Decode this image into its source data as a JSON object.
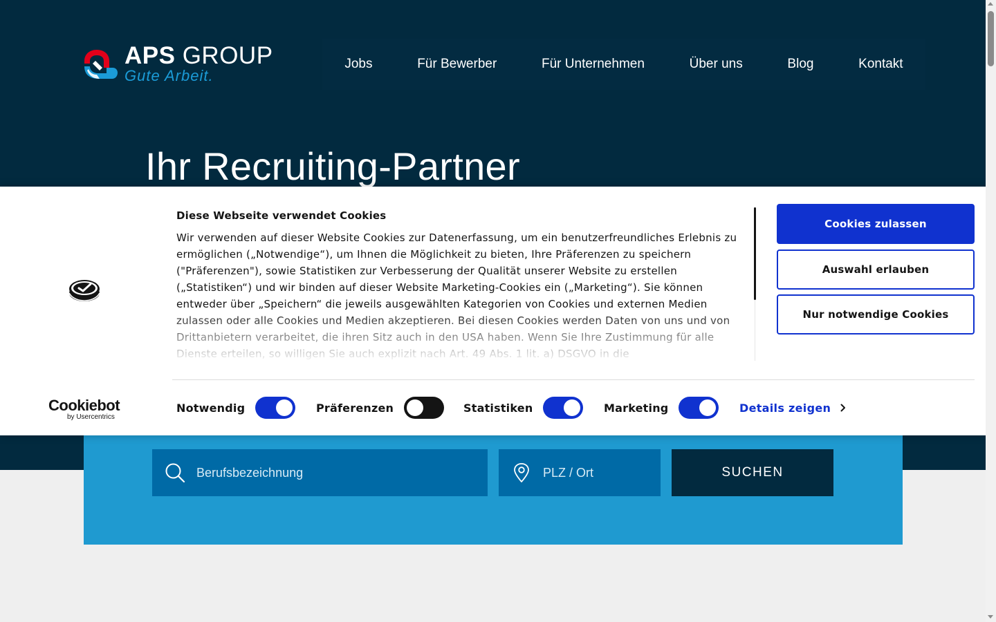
{
  "header": {
    "logo": {
      "name": "APS",
      "name_suffix": "GROUP",
      "tagline": "Gute Arbeit."
    },
    "nav": [
      {
        "label": "Jobs"
      },
      {
        "label": "Für Bewerber"
      },
      {
        "label": "Für Unternehmen"
      },
      {
        "label": "Über uns"
      },
      {
        "label": "Blog"
      },
      {
        "label": "Kontakt"
      }
    ]
  },
  "hero": {
    "title": "Ihr Recruiting-Partner"
  },
  "search": {
    "job_placeholder": "Berufsbezeichnung",
    "location_placeholder": "PLZ / Ort",
    "button_label": "SUCHEN"
  },
  "cookie_banner": {
    "title": "Diese Webseite verwendet Cookies",
    "text": "Wir verwenden auf dieser Website Cookies zur Datenerfassung, um ein benutzerfreundliches Erlebnis zu ermöglichen („Notwendige“), um Ihnen die Möglichkeit zu bieten, Ihre Präferenzen zu speichern (\"Präferenzen\"), sowie Statistiken zur Verbesserung der Qualität unserer Website zu erstellen („Statistiken“) und wir binden auf dieser Website Marketing-Cookies ein („Marketing“). Sie können entweder über „Speichern“ die jeweils ausgewählten Kategorien von Cookies und externen Medien zulassen oder alle Cookies und Medien akzeptieren. Bei diesen Cookies werden Daten von uns und von Drittanbietern verarbeitet, die ihren Sitz auch in den USA haben. Wenn Sie Ihre Zustimmung für alle Dienste erteilen, so willigen Sie auch explizit nach Art. 49 Abs. 1 lit. a) DSGVO in die",
    "buttons": {
      "allow_all": "Cookies zulassen",
      "allow_selection": "Auswahl erlauben",
      "necessary_only": "Nur notwendige Cookies"
    },
    "toggles": [
      {
        "label": "Notwendig",
        "on": true
      },
      {
        "label": "Präferenzen",
        "on": false
      },
      {
        "label": "Statistiken",
        "on": true
      },
      {
        "label": "Marketing",
        "on": true
      }
    ],
    "details_link": "Details zeigen",
    "provider": {
      "name": "Cookiebot",
      "by": "by Usercentrics"
    }
  },
  "colors": {
    "navy": "#022a3f",
    "light_blue": "#1f9ad0",
    "field_blue": "#006aa6",
    "cookiebot_blue": "#1032cf",
    "logo_red": "#e2001a"
  }
}
